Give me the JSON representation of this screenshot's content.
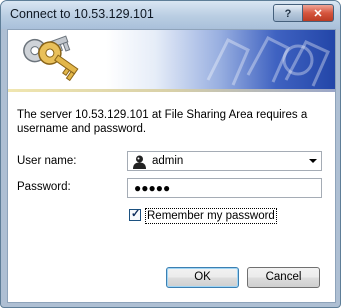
{
  "window": {
    "title": "Connect to 10.53.129.101",
    "help_label": "?",
    "close_label": "✕"
  },
  "message": "The server 10.53.129.101 at File Sharing Area requires a username and password.",
  "form": {
    "username_label": "User name:",
    "username_value": "admin",
    "password_label": "Password:",
    "password_mask": "●●●●●",
    "remember_label": "Remember my password",
    "remember_checked": true
  },
  "buttons": {
    "ok_label": "OK",
    "cancel_label": "Cancel"
  },
  "colors": {
    "titlebar": "#b9cde2",
    "close_button": "#d5553e",
    "banner_blue": "#2346a8",
    "default_button_border": "#3c7fb1"
  }
}
